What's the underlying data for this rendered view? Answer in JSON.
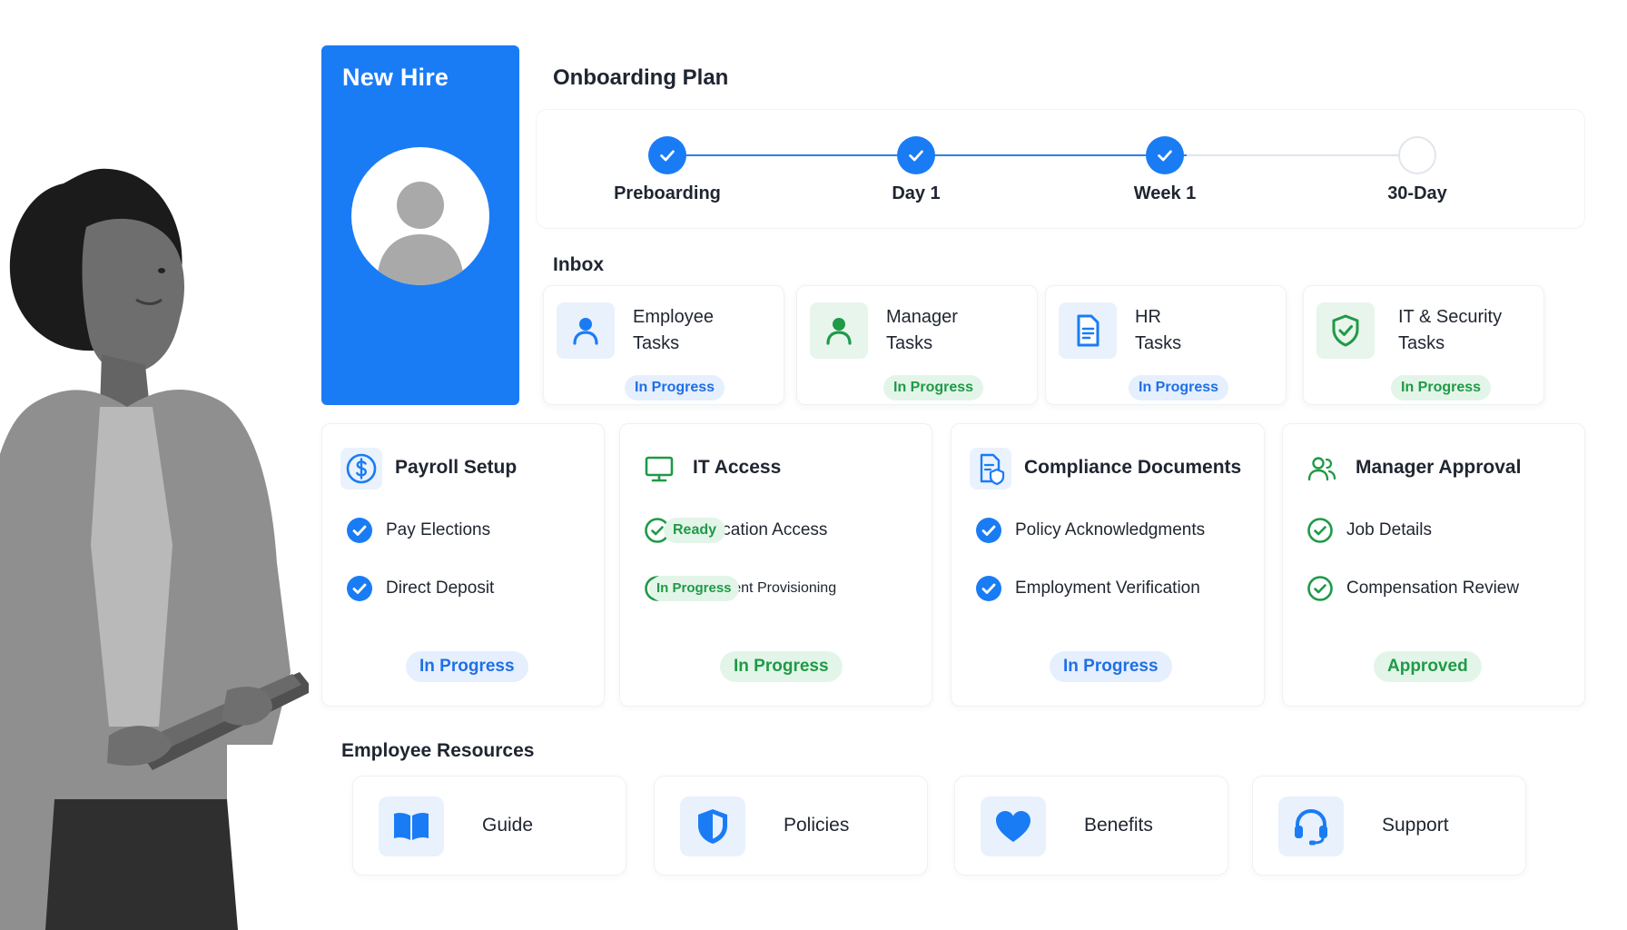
{
  "hire_card": {
    "title": "New Hire"
  },
  "plan": {
    "title": "Onboarding Plan",
    "steps": [
      {
        "label": "Preboarding",
        "done": true
      },
      {
        "label": "Day 1",
        "done": true
      },
      {
        "label": "Week 1",
        "done": true
      },
      {
        "label": "30-Day",
        "done": false
      }
    ]
  },
  "inbox": {
    "title": "Inbox",
    "cards": [
      {
        "line1": "Employee",
        "line2": "Tasks",
        "status": "In Progress",
        "icon": "person-icon"
      },
      {
        "line1": "Manager",
        "line2": "Tasks",
        "status": "In Progress",
        "icon": "person-icon"
      },
      {
        "line1": "HR",
        "line2": "Tasks",
        "status": "In Progress",
        "icon": "document-icon"
      },
      {
        "line1": "IT & Security",
        "line2": "Tasks",
        "status": "In Progress",
        "icon": "shield-check-icon"
      }
    ]
  },
  "tasks": [
    {
      "title": "Payroll Setup",
      "icon": "dollar-icon",
      "items": [
        {
          "label": "Pay Elections"
        },
        {
          "label": "Direct Deposit"
        }
      ],
      "status": "In Progress"
    },
    {
      "title": "IT Access",
      "icon": "monitor-icon",
      "items": [
        {
          "label": "Application Access",
          "badge": "Ready"
        },
        {
          "label": "Equipment Provisioning",
          "badge": "In Progress"
        }
      ],
      "status": "In Progress"
    },
    {
      "title": "Compliance Documents",
      "icon": "document-shield-icon",
      "items": [
        {
          "label": "Policy Acknowledgments"
        },
        {
          "label": "Employment Verification"
        }
      ],
      "status": "In Progress"
    },
    {
      "title": "Manager Approval",
      "icon": "users-icon",
      "items": [
        {
          "label": "Job Details"
        },
        {
          "label": "Compensation Review"
        }
      ],
      "status": "Approved"
    }
  ],
  "resources": {
    "title": "Employee Resources",
    "items": [
      {
        "label": "Guide",
        "icon": "book-icon"
      },
      {
        "label": "Policies",
        "icon": "shield-icon"
      },
      {
        "label": "Benefits",
        "icon": "heart-icon"
      },
      {
        "label": "Support",
        "icon": "headset-icon"
      }
    ]
  },
  "colors": {
    "primary": "#1a7cf5",
    "success": "#1f9a47",
    "pill_blue_bg": "#e5effd",
    "pill_green_bg": "#e3f5e8"
  }
}
